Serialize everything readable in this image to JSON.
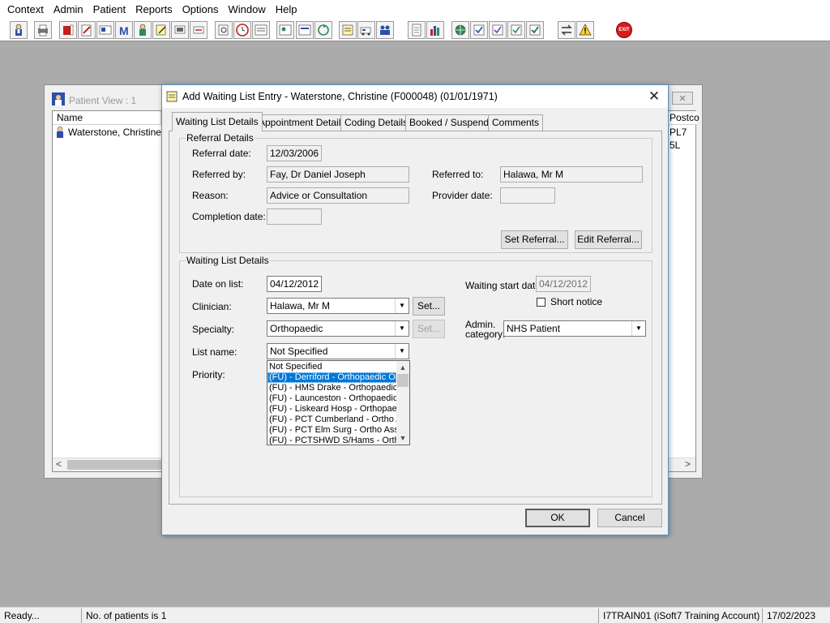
{
  "menu": [
    "Context",
    "Admin",
    "Patient",
    "Reports",
    "Options",
    "Window",
    "Help"
  ],
  "toolbar": {
    "exit_label": "EXIT"
  },
  "patient_view": {
    "title": "Patient View : 1",
    "columns": {
      "name": "Name",
      "postcode": "Postco"
    },
    "row": {
      "name": "Waterstone, Christine...",
      "postcode": "PL7 5L"
    }
  },
  "dialog": {
    "title": "Add Waiting List Entry - Waterstone, Christine (F000048) (01/01/1971)",
    "tabs": [
      "Waiting List Details",
      "Appointment Details",
      "Coding Details",
      "Booked / Suspend",
      "Comments"
    ],
    "referral": {
      "legend": "Referral Details",
      "referral_date_label": "Referral date:",
      "referral_date": "12/03/2006",
      "referred_by_label": "Referred by:",
      "referred_by": "Fay, Dr Daniel Joseph",
      "referred_to_label": "Referred to:",
      "referred_to": "Halawa, Mr M",
      "reason_label": "Reason:",
      "reason": "Advice or Consultation",
      "provider_date_label": "Provider date:",
      "provider_date": "",
      "completion_date_label": "Completion date:",
      "completion_date": "",
      "set_referral_button": "Set Referral...",
      "edit_referral_button": "Edit Referral..."
    },
    "waiting": {
      "legend": "Waiting List Details",
      "date_on_list_label": "Date on list:",
      "date_on_list": "04/12/2012",
      "waiting_start_label": "Waiting start date:",
      "waiting_start": "04/12/2012",
      "short_notice_label": "Short notice",
      "clinician_label": "Clinician:",
      "clinician": "Halawa, Mr M",
      "set_clinician_button": "Set...",
      "specialty_label": "Specialty:",
      "specialty": "Orthopaedic",
      "set_specialty_button": "Set...",
      "admin_category_label_1": "Admin.",
      "admin_category_label_2": "category:",
      "admin_category": "NHS Patient",
      "list_name_label": "List name:",
      "list_name": "Not Specified",
      "priority_label": "Priority:",
      "list_options": [
        "Not Specified",
        "(FU) - Derriford - Orthopaedic OP",
        "(FU) - HMS Drake - Orthopaedic",
        "(FU) - Launceston - Orthopaedic",
        "(FU) - Liskeard Hosp - Orthopaed",
        "(FU) - PCT Cumberland - Ortho A",
        "(FU) - PCT Elm Surg - Ortho Asse",
        "(FU) - PCTSHWD S/Hams - Orth"
      ],
      "selected_option_index": 1
    },
    "ok_button": "OK",
    "cancel_button": "Cancel"
  },
  "status": {
    "ready": "Ready...",
    "count": "No. of patients is 1",
    "account": "I7TRAIN01 (iSoft7 Training Account)",
    "date": "17/02/2023"
  }
}
